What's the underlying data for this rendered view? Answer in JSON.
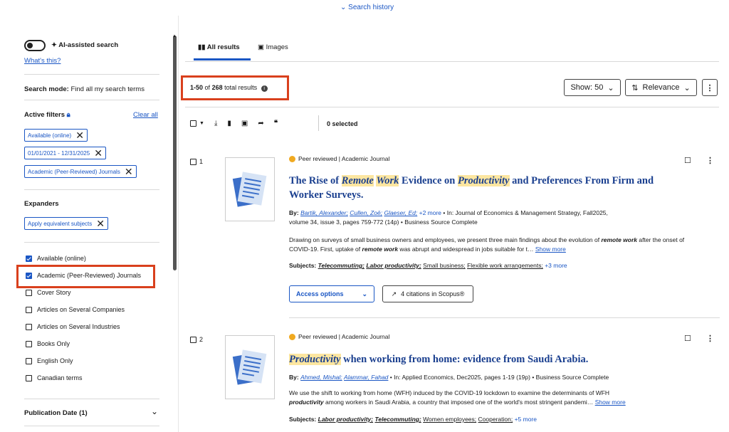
{
  "top": {
    "search_history": "Search history"
  },
  "sidebar": {
    "ai_search": "AI-assisted search",
    "whats_this": "What's this?",
    "search_mode_label": "Search mode:",
    "search_mode_value": "Find all my search terms",
    "active_filters": "Active filters",
    "clear_all": "Clear all",
    "filters": [
      "Available (online)",
      "01/01/2021 - 12/31/2025",
      "Academic (Peer-Reviewed) Journals"
    ],
    "expanders": "Expanders",
    "expander_chip": "Apply equivalent subjects",
    "checkboxes": [
      {
        "label": "Available (online)",
        "checked": true
      },
      {
        "label": "Academic (Peer-Reviewed) Journals",
        "checked": true
      },
      {
        "label": "Cover Story",
        "checked": false
      },
      {
        "label": "Articles on Several Companies",
        "checked": false
      },
      {
        "label": "Articles on Several Industries",
        "checked": false
      },
      {
        "label": "Books Only",
        "checked": false
      },
      {
        "label": "English Only",
        "checked": false
      },
      {
        "label": "Canadian terms",
        "checked": false
      }
    ],
    "pub_date": "Publication Date (1)"
  },
  "tabs": {
    "all": "All results",
    "images": "Images"
  },
  "results_count": {
    "range": "1-50",
    "of": "of",
    "total": "268",
    "suffix": "total results"
  },
  "controls": {
    "show": "Show: 50",
    "sort": "Relevance",
    "selected": "0 selected"
  },
  "results": [
    {
      "num": "1",
      "badge": "Peer reviewed",
      "type": "Academic Journal",
      "title_parts": [
        "The Rise of ",
        "Remote",
        " ",
        "Work",
        " Evidence on ",
        "Productivity",
        " and Preferences From Firm and Worker Surveys."
      ],
      "by": "By:",
      "authors": [
        "Bartik, Alexander;",
        "Cullen, Zoë;",
        "Glaeser, Ed;"
      ],
      "more_authors": "+2 more",
      "source_line": "In: Journal of Economics & Management Strategy, Fall2025,",
      "source_line2": "volume 34, issue 3, pages 759-772 (14p) • Business Source Complete",
      "abstract_a": "Drawing on surveys of small business owners and employees, we present three main findings about the evolution of ",
      "abstract_b": "remote work",
      "abstract_c": " after the onset of COVID-19. First, uptake of ",
      "abstract_d": "remote work",
      "abstract_e": " was abrupt and widespread in jobs suitable for t…",
      "show_more": "Show more",
      "subjects_label": "Subjects:",
      "subjects": [
        "Telecommuting;",
        "Labor productivity;",
        "Small business;",
        "Flexible work arrangements;"
      ],
      "subjects_more": "+3 more",
      "access": "Access options",
      "citations": "4 citations in Scopus®"
    },
    {
      "num": "2",
      "badge": "Peer reviewed",
      "type": "Academic Journal",
      "title_hl": "Productivity",
      "title_rest": " when working from home: evidence from Saudi Arabia.",
      "by": "By:",
      "authors": [
        "Ahmed, Mishal;",
        "Alammar, Fahad"
      ],
      "source_line": "In: Applied Economics, Dec2025, pages 1-19 (19p) • Business Source Complete",
      "abstract_a": "We use the shift to working from home (WFH) induced by the COVID-19 lockdown to examine the determinants of WFH",
      "abstract_b": "productivity",
      "abstract_c": " among workers in Saudi Arabia, a country that imposed one of the world's most stringent pandemi…",
      "show_more": "Show more",
      "subjects_label": "Subjects:",
      "subjects": [
        "Labor productivity;",
        "Telecommuting;",
        "Women employees;",
        "Cooperation;"
      ],
      "subjects_more": "+5 more"
    }
  ],
  "colors": {
    "accent": "#1a56c4",
    "highlight_box": "#d9401d",
    "title": "#1a3f8f",
    "badge": "#f0a920"
  }
}
